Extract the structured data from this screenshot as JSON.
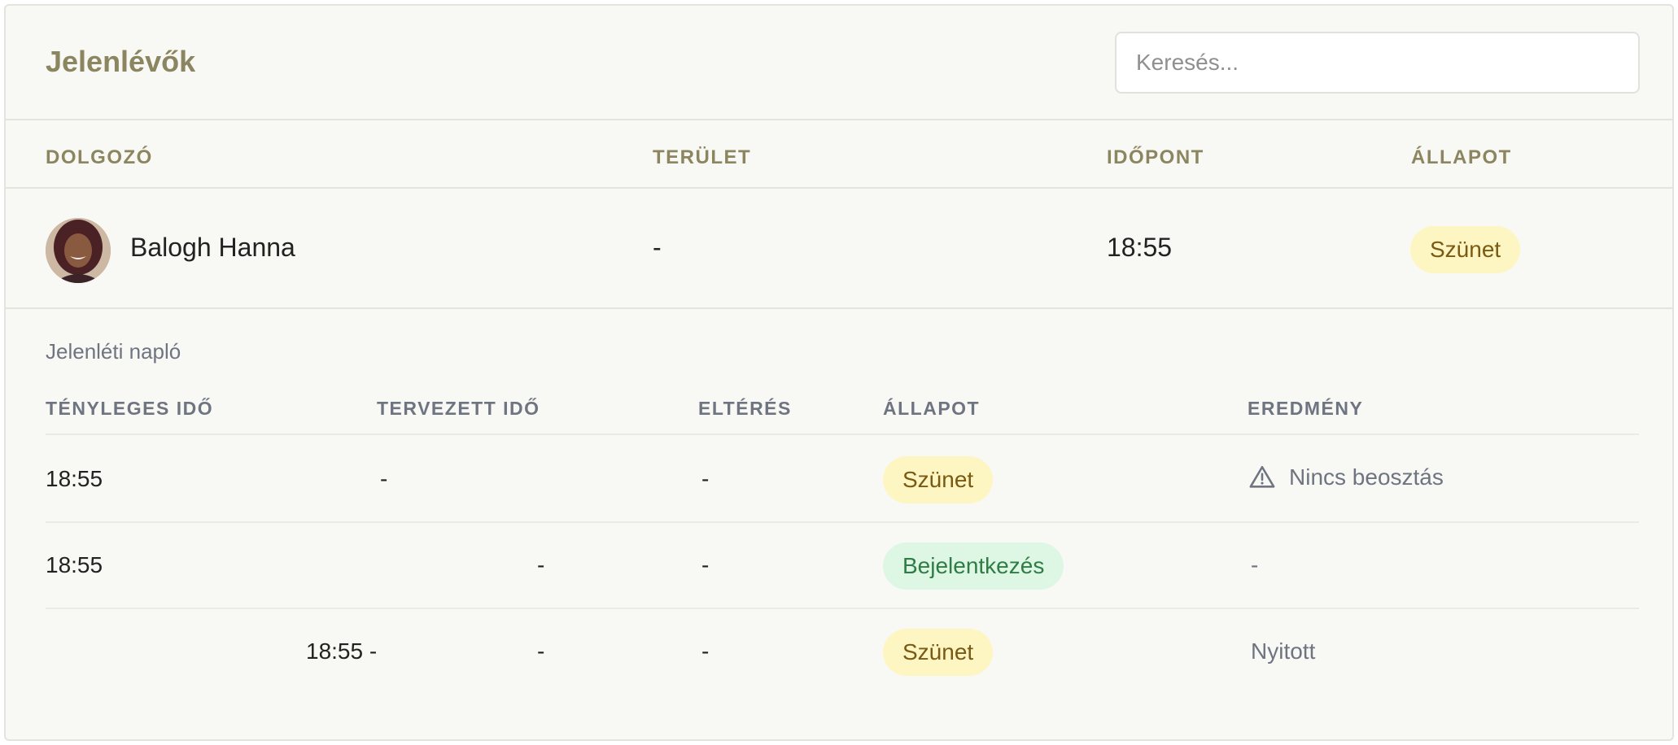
{
  "header": {
    "title": "Jelenlévők",
    "search_placeholder": "Keresés..."
  },
  "table": {
    "columns": [
      "DOLGOZÓ",
      "TERÜLET",
      "IDŐPONT",
      "ÁLLAPOT"
    ],
    "row": {
      "name": "Balogh Hanna",
      "area": "-",
      "time": "18:55",
      "status": "Szünet"
    }
  },
  "log": {
    "title": "Jelenléti napló",
    "columns": [
      "TÉNYLEGES IDŐ",
      "TERVEZETT IDŐ",
      "ELTÉRÉS",
      "ÁLLAPOT",
      "EREDMÉNY"
    ],
    "rows": [
      {
        "actual": "18:55",
        "planned": "-",
        "diff": "-",
        "status": "Szünet",
        "result": "Nincs beosztás"
      },
      {
        "actual": "18:55",
        "planned": "-",
        "diff": "-",
        "status": "Bejelentkezés",
        "result": "-"
      },
      {
        "actual": "18:55 -",
        "planned": "-",
        "diff": "-",
        "status": "Szünet",
        "result": "Nyitott"
      }
    ]
  },
  "colors": {
    "accent": "#8b8560",
    "badge_yellow_bg": "#fdf6c3",
    "badge_green_bg": "#ddf7e4"
  },
  "icons": {
    "warning": "warning-triangle-icon"
  }
}
